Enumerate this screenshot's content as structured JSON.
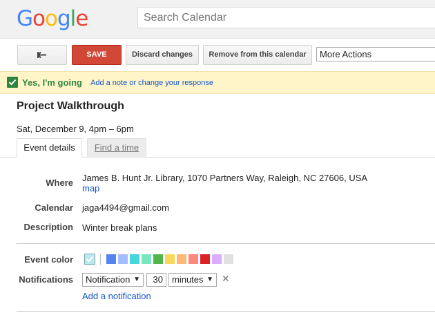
{
  "header": {
    "logo_letters": [
      {
        "char": "G",
        "color": "#4285F4"
      },
      {
        "char": "o",
        "color": "#EA4335"
      },
      {
        "char": "o",
        "color": "#FBBC05"
      },
      {
        "char": "g",
        "color": "#4285F4"
      },
      {
        "char": "l",
        "color": "#34A853"
      },
      {
        "char": "e",
        "color": "#EA4335"
      }
    ],
    "search_placeholder": "Search Calendar"
  },
  "toolbar": {
    "back_icon": "back-arrow-icon",
    "save_label": "SAVE",
    "discard_label": "Discard changes",
    "remove_label": "Remove from this calendar",
    "more_actions_label": "More Actions"
  },
  "rsvp": {
    "icon": "checkbox-checked-icon",
    "status": "Yes, I'm going",
    "note_link": "Add a note or change your response"
  },
  "event": {
    "title": "Project Walkthrough",
    "time": "Sat, December 9, 4pm – 6pm"
  },
  "tabs": [
    {
      "label": "Event details",
      "active": true
    },
    {
      "label": "Find a time",
      "active": false
    }
  ],
  "details": {
    "where_label": "Where",
    "where_value": "James B. Hunt Jr. Library, 1070 Partners Way, Raleigh, NC 27606, USA",
    "map_link": "map",
    "calendar_label": "Calendar",
    "calendar_value": "jaga4494@gmail.com",
    "description_label": "Description",
    "description_value": "Winter break plans"
  },
  "event_color": {
    "label": "Event color",
    "selected_color": "#bce8f1",
    "swatches": [
      "#5484ed",
      "#a4bdfc",
      "#46d6db",
      "#7ae7bf",
      "#51b749",
      "#fbd75b",
      "#ffb878",
      "#ff887c",
      "#dc2127",
      "#dbadff",
      "#e1e1e1"
    ]
  },
  "notifications": {
    "label": "Notifications",
    "method": "Notification",
    "amount": "30",
    "unit": "minutes",
    "remove_icon": "close-icon",
    "add_link": "Add a notification"
  }
}
